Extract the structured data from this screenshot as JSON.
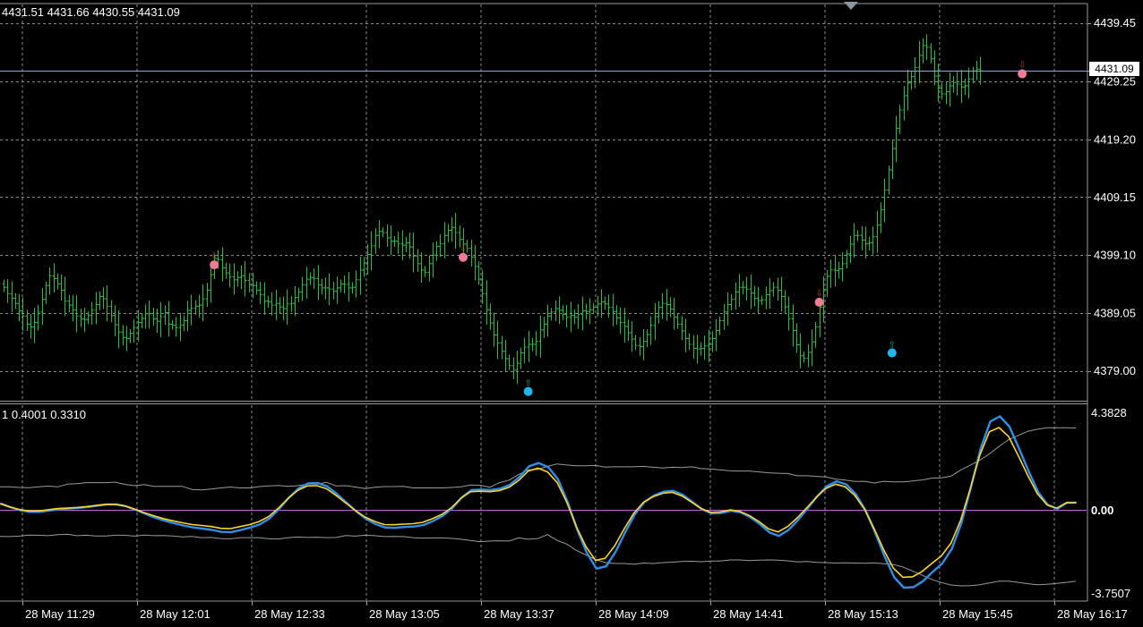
{
  "header": {
    "ohlc": "4431.51 4431.66 4430.55 4431.09",
    "oscillator_values": "1 0.4001 0.3310",
    "current_price": "4431.09"
  },
  "colors": {
    "background": "#000000",
    "grid": "#8c8c8c",
    "candle": "#1fc23a",
    "sell_marker": "#f07b94",
    "buy_marker": "#1fb6f0",
    "osc_fast": "#ffd42a",
    "osc_slow": "#2f8fe6",
    "osc_band": "#9a9a9a",
    "zero_line": "#c060e0",
    "current_price_line": "#8fa8c8"
  },
  "chart_data": [
    {
      "type": "candlestick",
      "title": "",
      "y_ticks": [
        "4439.45",
        "4429.25",
        "4419.20",
        "4409.15",
        "4399.10",
        "4389.05",
        "4379.00"
      ],
      "ylim": [
        4375,
        4441
      ],
      "x_ticks": [
        "28 May 11:29",
        "28 May 12:01",
        "28 May 12:33",
        "28 May 13:05",
        "28 May 13:37",
        "28 May 14:09",
        "28 May 14:41",
        "28 May 15:13",
        "28 May 15:45",
        "28 May 16:17"
      ],
      "closes": [
        4393.5,
        4392.4,
        4391.6,
        4390.7,
        4389.4,
        4388.5,
        4387.1,
        4386.6,
        4387.4,
        4389.2,
        4391.4,
        4393.8,
        4395.5,
        4395.0,
        4394.1,
        4393.0,
        4391.1,
        4390.4,
        4389.6,
        4388.5,
        4388.0,
        4387.9,
        4388.6,
        4389.5,
        4390.5,
        4391.9,
        4391.5,
        4390.2,
        4388.6,
        4387.0,
        4385.7,
        4384.8,
        4384.6,
        4385.5,
        4386.5,
        4387.4,
        4388.1,
        4388.9,
        4388.9,
        4388.0,
        4387.6,
        4388.4,
        4389.1,
        4387.1,
        4386.9,
        4386.5,
        4386.9,
        4387.7,
        4389.5,
        4389.9,
        4390.2,
        4390.4,
        4391.5,
        4393.0,
        4395.7,
        4398.5,
        4398.3,
        4396.9,
        4396.0,
        4395.3,
        4394.8,
        4395.2,
        4395.5,
        4394.7,
        4394.0,
        4393.8,
        4393.0,
        4392.2,
        4391.1,
        4391.0,
        4390.4,
        4390.7,
        4390.1,
        4389.8,
        4390.6,
        4390.7,
        4391.7,
        4392.7,
        4393.9,
        4394.9,
        4395.2,
        4395.0,
        4393.9,
        4393.4,
        4393.4,
        4393.2,
        4392.8,
        4393.4,
        4394.1,
        4394.0,
        4393.4,
        4393.5,
        4394.8,
        4396.5,
        4397.7,
        4399.2,
        4400.7,
        4402.5,
        4403.2,
        4403.0,
        4402.1,
        4401.5,
        4401.5,
        4401.1,
        4400.8,
        4401.2,
        4400.5,
        4398.9,
        4397.6,
        4396.5,
        4396.1,
        4397.6,
        4399.1,
        4400.6,
        4401.1,
        4402.5,
        4403.4,
        4403.9,
        4403.0,
        4401.8,
        4401.0,
        4400.3,
        4398.7,
        4397.1,
        4394.9,
        4392.4,
        4389.6,
        4387.3,
        4385.2,
        4383.8,
        4382.4,
        4381.1,
        4379.9,
        4379.1,
        4380.3,
        4382.1,
        4383.1,
        4383.6,
        4383.6,
        4384.1,
        4386.1,
        4387.1,
        4388.5,
        4389.2,
        4389.8,
        4389.5,
        4388.8,
        4388.3,
        4388.6,
        4388.3,
        4388.8,
        4389.4,
        4389.3,
        4389.6,
        4390.0,
        4390.6,
        4391.0,
        4390.6,
        4390.0,
        4389.3,
        4388.2,
        4387.4,
        4386.7,
        4385.6,
        4384.5,
        4383.4,
        4383.2,
        4384.1,
        4385.3,
        4386.9,
        4388.4,
        4390.0,
        4390.7,
        4390.5,
        4389.7,
        4388.3,
        4387.1,
        4385.9,
        4384.6,
        4383.6,
        4382.9,
        4382.8,
        4382.9,
        4383.3,
        4383.6,
        4384.6,
        4386.0,
        4387.7,
        4389.2,
        4390.5,
        4391.4,
        4392.7,
        4393.5,
        4393.5,
        4393.2,
        4392.5,
        4391.6,
        4391.2,
        4391.3,
        4392.2,
        4392.9,
        4393.5,
        4393.0,
        4391.9,
        4390.1,
        4388.0,
        4386.0,
        4383.5,
        4381.6,
        4381.2,
        4382.2,
        4384.0,
        4386.6,
        4390.0,
        4393.1,
        4395.4,
        4396.5,
        4396.4,
        4396.7,
        4397.6,
        4399.3,
        4401.0,
        4402.5,
        4402.5,
        4401.7,
        4401.1,
        4401.2,
        4402.3,
        4404.3,
        4407.0,
        4410.4,
        4413.9,
        4417.6,
        4421.1,
        4424.3,
        4426.8,
        4429.0,
        4430.1,
        4431.7,
        4433.8,
        4435.5,
        4435.2,
        4433.2,
        4430.2,
        4428.1,
        4427.1,
        4427.5,
        4428.5,
        4429.1,
        4428.8,
        4428.3,
        4428.5,
        4429.7,
        4431.1,
        4431.4,
        4431.1
      ],
      "sell_signals": [
        {
          "x_index": 55,
          "y": 4397.4
        },
        {
          "x_index": 120,
          "y": 4398.7
        },
        {
          "x_index": 213,
          "y": 4390.9
        },
        {
          "x_index": 266,
          "y": 4430.6
        }
      ],
      "buy_signals": [
        {
          "x_index": 137,
          "y": 4375.4
        },
        {
          "x_index": 232,
          "y": 4382.1
        }
      ]
    },
    {
      "type": "line",
      "title": "",
      "y_ticks": [
        "4.3828",
        "0.00",
        "-3.7507"
      ],
      "ylim": [
        -3.7507,
        4.3828
      ],
      "series": [
        {
          "values": [
            0.34,
            0.17,
            0.04,
            -0.04,
            -0.04,
            0.02,
            0.08,
            0.11,
            0.14,
            0.18,
            0.24,
            0.3,
            0.3,
            0.22,
            0.06,
            -0.12,
            -0.29,
            -0.43,
            -0.55,
            -0.65,
            -0.74,
            -0.79,
            -0.85,
            -0.94,
            -0.95,
            -0.85,
            -0.74,
            -0.59,
            -0.32,
            0.11,
            0.61,
            1.02,
            1.25,
            1.26,
            1.1,
            0.76,
            0.37,
            -0.02,
            -0.35,
            -0.59,
            -0.74,
            -0.76,
            -0.72,
            -0.7,
            -0.63,
            -0.45,
            -0.22,
            0.13,
            0.62,
            0.95,
            0.97,
            0.95,
            1.01,
            1.18,
            1.54,
            2.02,
            2.16,
            1.97,
            1.43,
            0.41,
            -0.84,
            -1.88,
            -2.59,
            -2.49,
            -1.83,
            -0.95,
            -0.15,
            0.41,
            0.7,
            0.87,
            0.91,
            0.73,
            0.41,
            0.08,
            -0.11,
            -0.09,
            0.01,
            -0.06,
            -0.27,
            -0.58,
            -0.96,
            -1.12,
            -0.85,
            -0.4,
            0.13,
            0.67,
            1.12,
            1.34,
            1.2,
            0.76,
            0.05,
            -0.95,
            -2.04,
            -2.98,
            -3.45,
            -3.43,
            -3.16,
            -2.74,
            -2.36,
            -1.7,
            -0.54,
            1.08,
            2.82,
            4.03,
            4.26,
            3.8,
            2.81,
            1.78,
            0.85,
            0.27,
            0.1,
            0.38,
            0.38
          ]
        },
        {
          "values": [
            0.29,
            0.15,
            0.03,
            -0.04,
            -0.04,
            0.02,
            0.07,
            0.09,
            0.12,
            0.16,
            0.21,
            0.26,
            0.26,
            0.19,
            0.05,
            -0.11,
            -0.25,
            -0.38,
            -0.48,
            -0.57,
            -0.65,
            -0.69,
            -0.74,
            -0.82,
            -0.83,
            -0.74,
            -0.65,
            -0.51,
            -0.28,
            0.1,
            0.53,
            0.89,
            1.09,
            1.1,
            0.96,
            0.66,
            0.32,
            -0.02,
            -0.31,
            -0.51,
            -0.65,
            -0.66,
            -0.63,
            -0.61,
            -0.55,
            -0.39,
            -0.19,
            0.11,
            0.54,
            0.83,
            0.85,
            0.83,
            0.88,
            1.03,
            1.34,
            1.76,
            1.89,
            1.72,
            1.25,
            0.36,
            -0.74,
            -1.64,
            -2.26,
            -2.17,
            -1.6,
            -0.83,
            -0.13,
            0.36,
            0.61,
            0.76,
            0.8,
            0.64,
            0.36,
            0.07,
            -0.1,
            -0.08,
            0.01,
            -0.05,
            -0.24,
            -0.51,
            -0.84,
            -0.98,
            -0.74,
            -0.35,
            0.11,
            0.59,
            0.98,
            1.17,
            1.05,
            0.66,
            0.04,
            -0.83,
            -1.78,
            -2.61,
            -3.02,
            -3.0,
            -2.76,
            -2.4,
            -2.06,
            -1.49,
            -0.47,
            0.95,
            2.47,
            3.53,
            3.72,
            3.32,
            2.46,
            1.56,
            0.74,
            0.24,
            0.09,
            0.33,
            0.33
          ]
        },
        {
          "values": [
            1.05,
            1.05,
            1.02,
            1.01,
            1.05,
            1.08,
            1.05,
            1.17,
            1.19,
            1.24,
            1.24,
            1.24,
            1.26,
            1.16,
            1.1,
            1.15,
            1.07,
            1.07,
            1.07,
            1.07,
            0.93,
            0.91,
            0.95,
            1.0,
            1.04,
            1.0,
            1.0,
            1.06,
            1.09,
            1.11,
            1.07,
            1.1,
            1.17,
            1.17,
            1.25,
            1.09,
            1.1,
            1.04,
            0.97,
            1.03,
            1.06,
            1.06,
            1.07,
            1.0,
            1.0,
            1.0,
            1.0,
            1.02,
            1.05,
            1.13,
            1.12,
            1.03,
            1.24,
            1.35,
            1.61,
            1.81,
            1.83,
            1.97,
            2.08,
            2.03,
            2.0,
            2.0,
            2.01,
            1.94,
            1.95,
            1.95,
            1.95,
            1.97,
            1.93,
            1.9,
            1.93,
            1.92,
            1.95,
            1.87,
            1.85,
            1.81,
            1.77,
            1.76,
            1.76,
            1.72,
            1.68,
            1.66,
            1.65,
            1.55,
            1.55,
            1.52,
            1.49,
            1.4,
            1.35,
            1.29,
            1.3,
            1.22,
            1.3,
            1.27,
            1.27,
            1.31,
            1.36,
            1.44,
            1.45,
            1.53,
            1.8,
            2.02,
            2.25,
            2.53,
            2.87,
            3.17,
            3.36,
            3.55,
            3.64,
            3.71,
            3.71,
            3.71,
            3.7
          ]
        },
        {
          "values": [
            -1.18,
            -1.19,
            -1.17,
            -1.12,
            -1.13,
            -1.15,
            -1.1,
            -1.08,
            -1.15,
            -1.13,
            -1.16,
            -1.16,
            -1.13,
            -1.13,
            -1.17,
            -1.12,
            -1.15,
            -1.14,
            -1.16,
            -1.2,
            -1.18,
            -1.24,
            -1.23,
            -1.28,
            -1.29,
            -1.24,
            -1.24,
            -1.24,
            -1.29,
            -1.3,
            -1.24,
            -1.21,
            -1.23,
            -1.22,
            -1.24,
            -1.23,
            -1.14,
            -1.17,
            -1.13,
            -1.15,
            -1.19,
            -1.18,
            -1.19,
            -1.24,
            -1.26,
            -1.25,
            -1.25,
            -1.27,
            -1.31,
            -1.37,
            -1.42,
            -1.39,
            -1.38,
            -1.39,
            -1.25,
            -1.31,
            -1.28,
            -1.1,
            -1.36,
            -1.53,
            -1.81,
            -2.02,
            -2.22,
            -2.36,
            -2.4,
            -2.4,
            -2.44,
            -2.38,
            -2.4,
            -2.36,
            -2.34,
            -2.31,
            -2.3,
            -2.32,
            -2.29,
            -2.29,
            -2.24,
            -2.24,
            -2.27,
            -2.25,
            -2.24,
            -2.25,
            -2.28,
            -2.33,
            -2.31,
            -2.35,
            -2.36,
            -2.38,
            -2.37,
            -2.38,
            -2.39,
            -2.37,
            -2.41,
            -2.45,
            -2.56,
            -2.74,
            -2.93,
            -3.12,
            -3.26,
            -3.37,
            -3.41,
            -3.4,
            -3.36,
            -3.28,
            -3.2,
            -3.2,
            -3.25,
            -3.31,
            -3.36,
            -3.34,
            -3.3,
            -3.25,
            -3.2
          ]
        }
      ]
    }
  ]
}
